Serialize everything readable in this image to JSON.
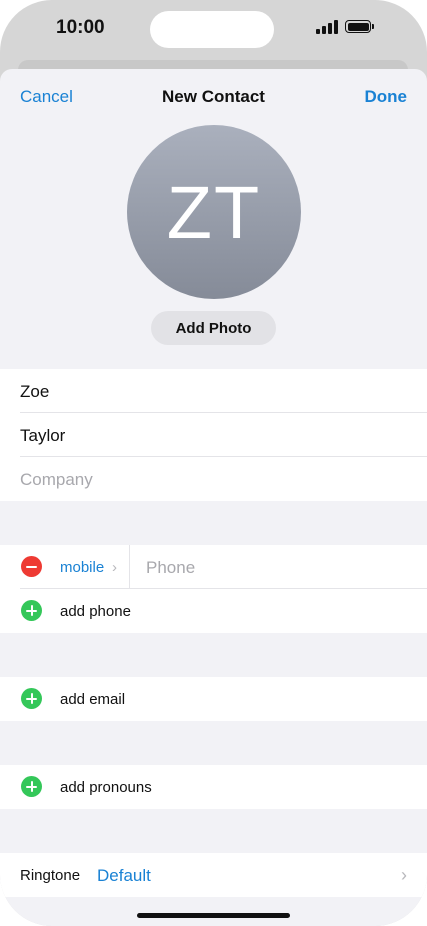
{
  "status": {
    "time": "10:00"
  },
  "nav": {
    "cancel": "Cancel",
    "title": "New Contact",
    "done": "Done"
  },
  "avatar": {
    "initials": "ZT"
  },
  "photo": {
    "add_label": "Add Photo"
  },
  "name": {
    "first": "Zoe",
    "last": "Taylor",
    "company_placeholder": "Company"
  },
  "phone": {
    "label": "mobile",
    "placeholder": "Phone",
    "add_label": "add phone"
  },
  "email": {
    "add_label": "add email"
  },
  "pronouns": {
    "add_label": "add pronouns"
  },
  "ringtone": {
    "label": "Ringtone",
    "value": "Default"
  },
  "colors": {
    "accent": "#1a82d4",
    "remove": "#ee3a33",
    "add": "#34c759"
  }
}
